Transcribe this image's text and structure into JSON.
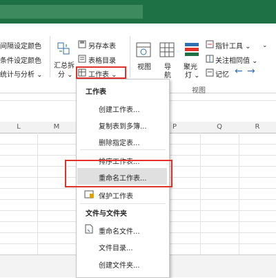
{
  "ribbon": {
    "left_items": [
      "间隔设定颜色",
      "条件设定颜色",
      "统计与分析"
    ],
    "summary": [
      "汇总拆",
      "分"
    ],
    "save_sheet": "另存本表",
    "table_toc": "表格目录",
    "worksheet": "工作表",
    "view_label": "视图",
    "view_btn": "视图",
    "nav_btn": [
      "导",
      "航"
    ],
    "spotlight_btn": [
      "聚光",
      "灯"
    ],
    "pointer_tool": "指针工具",
    "related_cols": "关注相同值",
    "memo": "记忆",
    "group_view": "视图"
  },
  "columns": [
    "L",
    "M",
    "P",
    "Q",
    "R"
  ],
  "menu": {
    "section1": "工作表",
    "items1": [
      "创建工作表...",
      "复制表到多簿...",
      "删除指定表...",
      "排序工作表...",
      "重命名工作表...",
      "保护工作表"
    ],
    "section2": "文件与文件夹",
    "items2": [
      "重命名文件...",
      "文件目录...",
      "创建文件夹..."
    ]
  },
  "colors": {
    "accent_green": "#1e7145",
    "highlight": "#e0312a",
    "selected_bg": "#e0e0e0"
  }
}
